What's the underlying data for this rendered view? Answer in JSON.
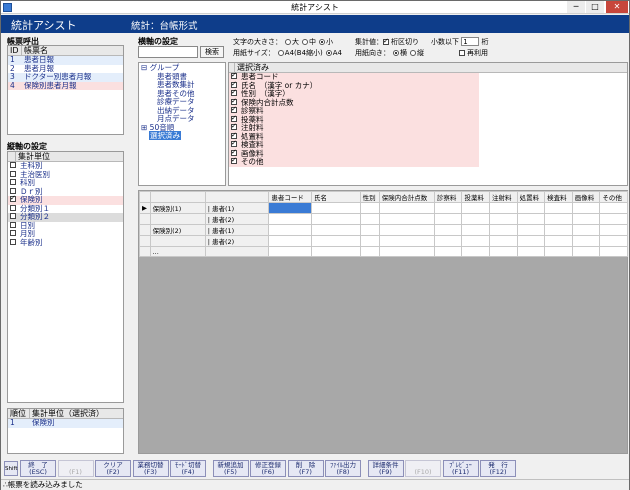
{
  "window": {
    "title": "統計アシスト",
    "min_label": "─",
    "max_label": "□",
    "close_label": "✕"
  },
  "header": {
    "app_name": "統計アシスト",
    "subtitle": "統計：台帳形式"
  },
  "report_list": {
    "title": "帳票呼出",
    "columns": [
      "ID",
      "帳票名"
    ],
    "rows": [
      {
        "id": "1",
        "name": "患者日報"
      },
      {
        "id": "2",
        "name": "患者月報"
      },
      {
        "id": "3",
        "name": "ドクター別患者月報"
      },
      {
        "id": "4",
        "name": "保険別患者月報"
      }
    ]
  },
  "vertical_axis": {
    "title": "縦軸の設定",
    "column": "集計単位",
    "items": [
      {
        "label": "主科別",
        "checked": false
      },
      {
        "label": "主治医別",
        "checked": false
      },
      {
        "label": "科別",
        "checked": false
      },
      {
        "label": "Ｄｒ別",
        "checked": false
      },
      {
        "label": "保険別",
        "checked": true
      },
      {
        "label": "分類別１",
        "checked": false
      },
      {
        "label": "分類別２",
        "checked": false
      },
      {
        "label": "日別",
        "checked": false
      },
      {
        "label": "月別",
        "checked": false
      },
      {
        "label": "年齢別",
        "checked": false
      }
    ]
  },
  "selected_units": {
    "columns": [
      "順位",
      "集計単位（選択済）"
    ],
    "rows": [
      {
        "order": "1",
        "name": "保険別"
      }
    ]
  },
  "horizontal_axis": {
    "title": "横軸の設定",
    "search_button": "検索",
    "tree": [
      "グループ",
      "患者頭書",
      "患者数集計",
      "患者その他",
      "診療データ",
      "出納データ",
      "月点データ",
      "50音順",
      "選択済み"
    ]
  },
  "selected_items": {
    "header": "選択済み",
    "items": [
      "患者コード",
      "氏名　（漢字 or カナ）",
      "性別　（漢字）",
      "保険内合計点数",
      "診察料",
      "投薬料",
      "注射料",
      "処置料",
      "検査料",
      "画像料",
      "その他"
    ]
  },
  "options": {
    "font_size_label": "文字の大きさ：",
    "font_sizes": [
      "大",
      "中",
      "小"
    ],
    "font_size_selected": "小",
    "total_label": "集計値：",
    "comma_label": "桁区切り",
    "comma_checked": true,
    "decimal_label": "小数以下",
    "decimal_value": "1",
    "decimal_unit": "桁",
    "paper_label": "用紙サイズ：",
    "papers": [
      "A4(B4縮小)",
      "A4"
    ],
    "paper_selected": "A4",
    "orientation_label": "用紙向き：",
    "orientations": [
      "横",
      "縦"
    ],
    "orientation_selected": "横",
    "reuse_label": "再利用",
    "reuse_checked": false
  },
  "grid": {
    "columns": [
      "患者コード",
      "氏名",
      "性別",
      "保険内合計点数",
      "診察料",
      "投薬料",
      "注射料",
      "処置料",
      "検査料",
      "画像料",
      "その他"
    ],
    "rows": [
      {
        "marker": "▶",
        "group": "保険別(1)",
        "sub": "| 患者(1)"
      },
      {
        "marker": "",
        "group": "",
        "sub": "| 患者(2)"
      },
      {
        "marker": "",
        "group": "保険別(2)",
        "sub": "| 患者(1)"
      },
      {
        "marker": "",
        "group": "",
        "sub": "| 患者(2)"
      },
      {
        "marker": "",
        "group": "...",
        "sub": ""
      }
    ]
  },
  "function_keys": {
    "shift_label": "Shift",
    "keys": [
      {
        "label": "終　了",
        "key": "(ESC)",
        "enabled": true
      },
      {
        "label": "",
        "key": "(F1)",
        "enabled": false
      },
      {
        "label": "クリア",
        "key": "(F2)",
        "enabled": true
      },
      {
        "label": "業務切替",
        "key": "(F3)",
        "enabled": true
      },
      {
        "label": "ﾓｰﾄﾞ切替",
        "key": "(F4)",
        "enabled": true
      },
      {
        "label": "新規追加",
        "key": "(F5)",
        "enabled": true
      },
      {
        "label": "修正登録",
        "key": "(F6)",
        "enabled": true
      },
      {
        "label": "削　除",
        "key": "(F7)",
        "enabled": true
      },
      {
        "label": "ﾌｧｲﾙ出力",
        "key": "(F8)",
        "enabled": true
      },
      {
        "label": "詳細条件",
        "key": "(F9)",
        "enabled": true
      },
      {
        "label": "",
        "key": "(F10)",
        "enabled": false
      },
      {
        "label": "ﾌﾟﾚﾋﾞｭｰ",
        "key": "(F11)",
        "enabled": true
      },
      {
        "label": "発　行",
        "key": "(F12)",
        "enabled": true
      }
    ]
  },
  "status": {
    "message": "帳票を読み込みました"
  },
  "colors": {
    "header_bg": "#0e3d8a",
    "selected_pink": "#fbe0e0",
    "cell_selected": "#3a7bd5",
    "grid_empty": "#a8a8a8"
  }
}
